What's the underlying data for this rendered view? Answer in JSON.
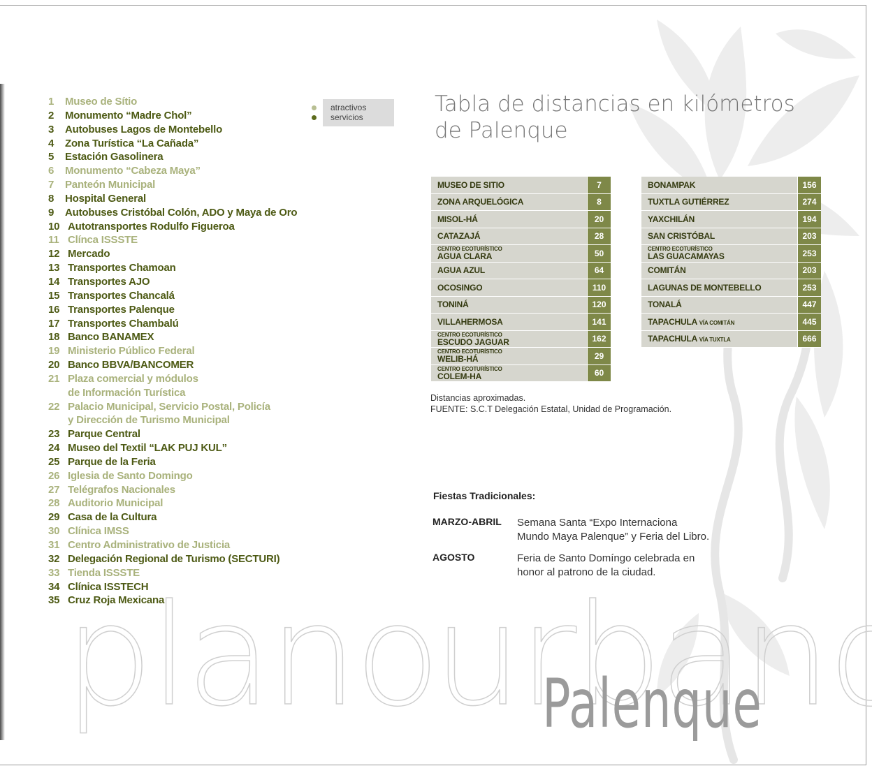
{
  "background": {
    "word_1": "plano",
    "word_2": "urbano",
    "title": "Palenque"
  },
  "colors": {
    "servicio_text": "#4d5a14",
    "atractivo_text": "#a9b27c",
    "table_name_bg": "#d6d6ce",
    "table_value_bg": "#7e8848"
  },
  "legend": {
    "items": [
      {
        "label": "atractivos",
        "color": "#b8bf93"
      },
      {
        "label": "servicios",
        "color": "#5c6b1c"
      }
    ]
  },
  "places": [
    {
      "num": "1",
      "name": "Museo de Sítio",
      "type": "atractivo"
    },
    {
      "num": "2",
      "name": "Monumento “Madre Chol”",
      "type": "servicio"
    },
    {
      "num": "3",
      "name": "Autobuses Lagos de Montebello",
      "type": "servicio"
    },
    {
      "num": "4",
      "name": "Zona Turística “La Cañada”",
      "type": "servicio"
    },
    {
      "num": "5",
      "name": "Estación Gasolinera",
      "type": "servicio"
    },
    {
      "num": "6",
      "name": "Monumento “Cabeza Maya”",
      "type": "atractivo"
    },
    {
      "num": "7",
      "name": "Panteón Municipal",
      "type": "atractivo"
    },
    {
      "num": "8",
      "name": "Hospital General",
      "type": "servicio"
    },
    {
      "num": "9",
      "name": "Autobuses Cristóbal Colón, ADO y Maya de Oro",
      "type": "servicio"
    },
    {
      "num": "10",
      "name": "Autotransportes Rodulfo Figueroa",
      "type": "servicio"
    },
    {
      "num": "11",
      "name": "Clínca ISSSTE",
      "type": "atractivo"
    },
    {
      "num": "12",
      "name": "Mercado",
      "type": "servicio"
    },
    {
      "num": "13",
      "name": "Transportes Chamoan",
      "type": "servicio"
    },
    {
      "num": "14",
      "name": "Transportes AJO",
      "type": "servicio"
    },
    {
      "num": "15",
      "name": "Transportes Chancalá",
      "type": "servicio"
    },
    {
      "num": "16",
      "name": "Transportes Palenque",
      "type": "servicio"
    },
    {
      "num": "17",
      "name": "Transportes Chambalú",
      "type": "servicio"
    },
    {
      "num": "18",
      "name": "Banco BANAMEX",
      "type": "servicio"
    },
    {
      "num": "19",
      "name": "Ministerio Público Federal",
      "type": "atractivo"
    },
    {
      "num": "20",
      "name": "Banco BBVA/BANCOMER",
      "type": "servicio"
    },
    {
      "num": "21",
      "name": "Plaza comercial y módulos",
      "type": "atractivo"
    },
    {
      "num": "",
      "name": "de Información Turística",
      "type": "atractivo"
    },
    {
      "num": "22",
      "name": "Palacio Municipal, Servicio Postal, Policía",
      "type": "atractivo"
    },
    {
      "num": "",
      "name": "y Dirección de Turismo Municipal",
      "type": "atractivo"
    },
    {
      "num": "23",
      "name": "Parque Central",
      "type": "servicio"
    },
    {
      "num": "24",
      "name": "Museo del Textil “LAK PUJ KUL”",
      "type": "servicio"
    },
    {
      "num": "25",
      "name": "Parque de la Feria",
      "type": "servicio"
    },
    {
      "num": "26",
      "name": "Iglesia de Santo Domingo",
      "type": "atractivo"
    },
    {
      "num": "27",
      "name": "Telégrafos Nacionales",
      "type": "atractivo"
    },
    {
      "num": "28",
      "name": "Auditorio Municipal",
      "type": "atractivo"
    },
    {
      "num": "29",
      "name": "Casa de la Cultura",
      "type": "servicio"
    },
    {
      "num": "30",
      "name": "Clínica IMSS",
      "type": "atractivo"
    },
    {
      "num": "31",
      "name": "Centro Administrativo de Justicia",
      "type": "atractivo"
    },
    {
      "num": "32",
      "name": "Delegación Regional de Turismo (SECTURI)",
      "type": "servicio"
    },
    {
      "num": "33",
      "name": "Tienda ISSSTE",
      "type": "atractivo"
    },
    {
      "num": "34",
      "name": "Clínica ISSTECH",
      "type": "servicio"
    },
    {
      "num": "35",
      "name": "Cruz Roja Mexicana",
      "type": "servicio"
    }
  ],
  "distances": {
    "title": "Tabla de distancias en kilómetros de Palenque",
    "table_1": [
      {
        "prefix": "",
        "name": "MUSEO DE SITIO",
        "suffix": "",
        "km": "7"
      },
      {
        "prefix": "",
        "name": "ZONA ARQUELÓGICA",
        "suffix": "",
        "km": "8"
      },
      {
        "prefix": "",
        "name": "MISOL-HÁ",
        "suffix": "",
        "km": "20"
      },
      {
        "prefix": "",
        "name": "CATAZAJÁ",
        "suffix": "",
        "km": "28"
      },
      {
        "prefix": "CENTRO ECOTURÍSTICO",
        "name": "AGUA CLARA",
        "suffix": "",
        "km": "50"
      },
      {
        "prefix": "",
        "name": "AGUA AZUL",
        "suffix": "",
        "km": "64"
      },
      {
        "prefix": "",
        "name": "OCOSINGO",
        "suffix": "",
        "km": "110"
      },
      {
        "prefix": "",
        "name": "TONINÁ",
        "suffix": "",
        "km": "120"
      },
      {
        "prefix": "",
        "name": "VILLAHERMOSA",
        "suffix": "",
        "km": "141"
      },
      {
        "prefix": "CENTRO ECOTURÍSTICO",
        "name": "ESCUDO JAGUAR",
        "suffix": "",
        "km": "162"
      },
      {
        "prefix": "CENTRO ECOTURÍSTICO",
        "name": "WELIB-HÁ",
        "suffix": "",
        "km": "29"
      },
      {
        "prefix": "CENTRO ECOTURÍSTICO",
        "name": "COLEM-HA",
        "suffix": "",
        "km": "60"
      }
    ],
    "table_2": [
      {
        "prefix": "",
        "name": "BONAMPAK",
        "suffix": "",
        "km": "156"
      },
      {
        "prefix": "",
        "name": "TUXTLA GUTIÉRREZ",
        "suffix": "",
        "km": "274"
      },
      {
        "prefix": "",
        "name": "YAXCHILÁN",
        "suffix": "",
        "km": "194"
      },
      {
        "prefix": "",
        "name": "SAN CRISTÓBAL",
        "suffix": "",
        "km": "203"
      },
      {
        "prefix": "CENTRO ECOTURÍSTICO",
        "name": "LAS GUACAMAYAS",
        "suffix": "",
        "km": "253"
      },
      {
        "prefix": "",
        "name": "COMITÁN",
        "suffix": "",
        "km": "203"
      },
      {
        "prefix": "",
        "name": "LAGUNAS DE MONTEBELLO",
        "suffix": "",
        "km": "253"
      },
      {
        "prefix": "",
        "name": "TONALÁ",
        "suffix": "",
        "km": "447"
      },
      {
        "prefix": "",
        "name": "TAPACHULA",
        "suffix": "VÍA COMITÁN",
        "km": "445"
      },
      {
        "prefix": "",
        "name": "TAPACHULA",
        "suffix": "VÍA TUXTLA",
        "km": "666"
      }
    ],
    "note_1": "Distancias aproximadas.",
    "note_2": "FUENTE: S.C.T Delegación Estatal, Unidad de Programación."
  },
  "fiestas": {
    "title": "Fiestas Tradicionales:",
    "items": [
      {
        "label": "MARZO-ABRIL",
        "line_1": "Semana Santa “Expo Internaciona",
        "line_2": "Mundo Maya Palenque” y Feria del Libro."
      },
      {
        "label": "AGOSTO",
        "line_1": "Feria de Santo Domíngo celebrada en",
        "line_2": "honor al patrono de la ciudad."
      }
    ]
  }
}
